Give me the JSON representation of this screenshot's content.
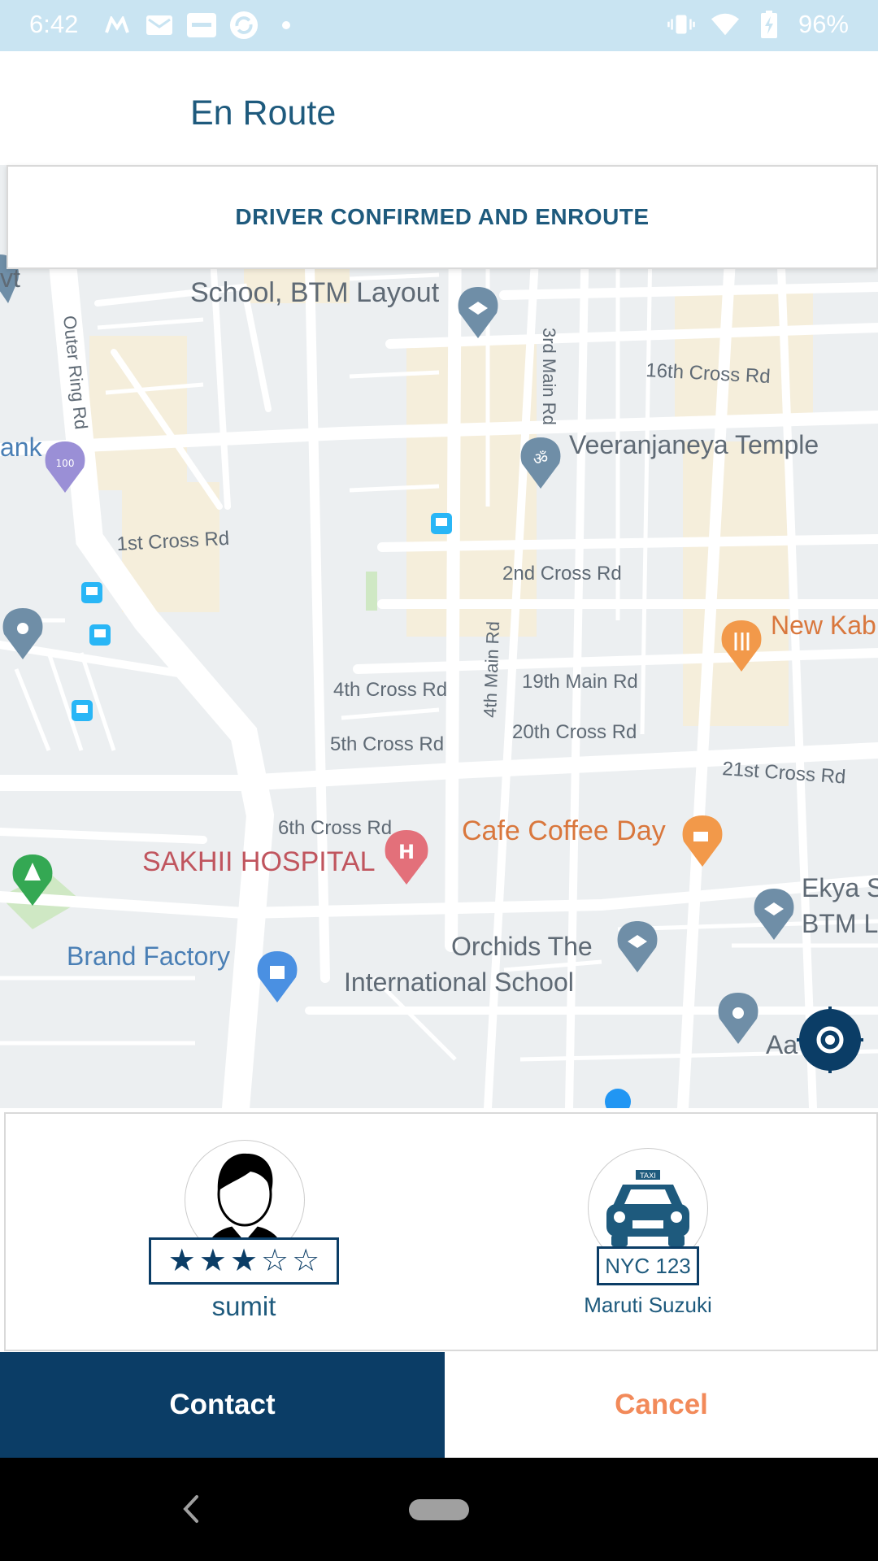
{
  "status_bar": {
    "time": "6:42",
    "battery": "96%",
    "left_icons": [
      "motorola-icon",
      "gmail-icon",
      "paytm-icon",
      "sync-app-icon",
      "dot-icon"
    ],
    "right_icons": [
      "vibrate-icon",
      "wifi-icon",
      "battery-charging-icon"
    ]
  },
  "header": {
    "title": "En Route"
  },
  "banner": {
    "text": "DRIVER CONFIRMED AND ENROUTE"
  },
  "map": {
    "labels": {
      "school_btm": "School, BTM Layout",
      "sixteenth_cross": "16th Cross Rd",
      "third_main": "3rd Main Rd",
      "veeranjaneya": "Veeranjaneya Temple",
      "outer_ring": "Outer Ring Rd",
      "bank_partial": "ank",
      "vt_partial": "vt",
      "first_cross": "1st Cross Rd",
      "second_cross": "2nd Cross Rd",
      "new_kab": "New Kab",
      "fourth_main": "4th Main Rd",
      "nineteenth_main": "19th Main Rd",
      "fourth_cross": "4th Cross Rd",
      "twentieth_cross": "20th Cross Rd",
      "fifth_cross": "5th Cross Rd",
      "twentyfirst_cross": "21st Cross Rd",
      "sixth_cross": "6th Cross Rd",
      "cafe_coffee_day": "Cafe Coffee Day",
      "sakhii_hospital": "SAKHII HOSPITAL",
      "ekya_1": "Ekya S",
      "ekya_2": "BTM L",
      "brand_factory": "Brand Factory",
      "orchids_1": "Orchids The",
      "orchids_2": "International School",
      "aa_partial": "Aa"
    },
    "accent": "#0b3d66"
  },
  "driver": {
    "name": "sumit",
    "rating": 3,
    "rating_max": 5,
    "stars": [
      "★",
      "★",
      "★",
      "☆",
      "☆"
    ]
  },
  "car": {
    "plate": "NYC 123",
    "model": "Maruti Suzuki",
    "taxi_sign": "TAXI"
  },
  "actions": {
    "contact": "Contact",
    "cancel": "Cancel"
  },
  "colors": {
    "primary": "#0b3d66",
    "cancel": "#f28a5a",
    "header_text": "#1e5a7d"
  }
}
